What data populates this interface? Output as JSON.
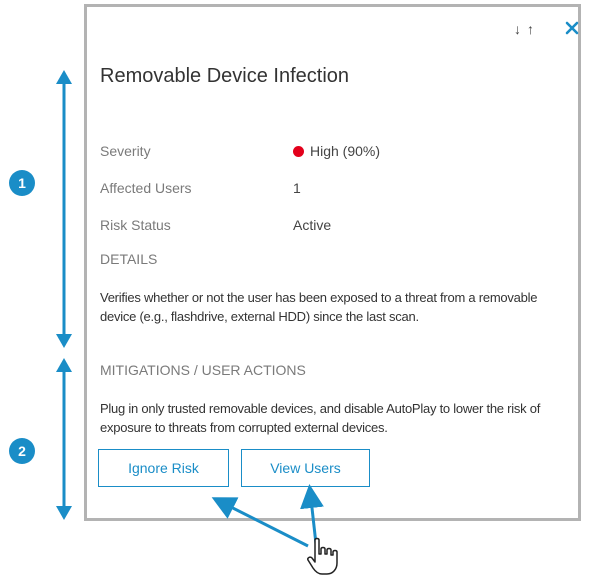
{
  "panel": {
    "sort_down_label": "↓",
    "sort_up_label": "↑",
    "title": "Removable Device Infection",
    "fields": {
      "severity": {
        "label": "Severity",
        "value": "High (90%)",
        "color": "#e3001b"
      },
      "affected_users": {
        "label": "Affected Users",
        "value": "1"
      },
      "risk_status": {
        "label": "Risk Status",
        "value": "Active"
      }
    },
    "details": {
      "heading": "DETAILS",
      "text": "Verifies whether or not the user has been exposed to a threat from a removable device (e.g., flashdrive, external HDD) since the last scan."
    },
    "mitigations": {
      "heading": "MITIGATIONS / USER ACTIONS",
      "text": "Plug in only trusted removable devices, and disable AutoPlay to lower the risk of exposure to threats from corrupted external devices."
    },
    "buttons": {
      "ignore_risk": "Ignore Risk",
      "view_users": "View Users"
    }
  },
  "annotations": {
    "badge_1": "1",
    "badge_2": "2",
    "accent_color": "#1a8dc7"
  }
}
